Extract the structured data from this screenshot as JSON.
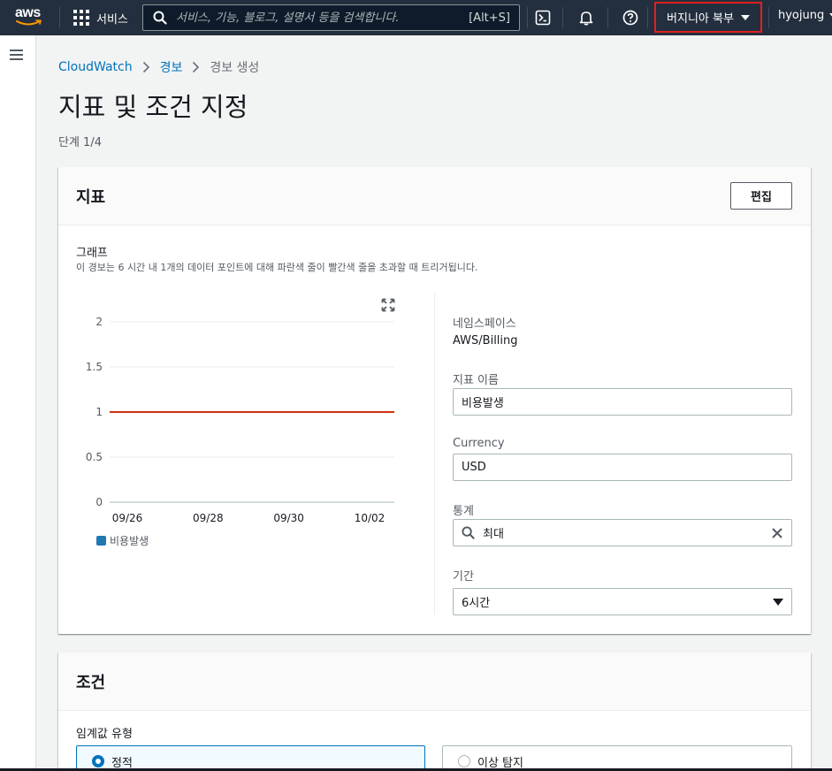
{
  "nav": {
    "services_label": "서비스",
    "search_placeholder": "서비스, 기능, 블로그, 설명서 등을 검색합니다.",
    "search_shortcut": "[Alt+S]",
    "region_label": "버지니아 북부",
    "user_label": "hyojung",
    "logo_text": "aws"
  },
  "breadcrumb": {
    "items": [
      "CloudWatch",
      "경보"
    ],
    "current": "경보 생성"
  },
  "page": {
    "title": "지표 및 조건 지정",
    "step": "단계 1/4"
  },
  "metric_panel": {
    "heading": "지표",
    "edit_button": "편집",
    "graph_title": "그래프",
    "graph_description": "이 경보는 6 시간 내 1개의 데이터 포인트에 대해 파란색 줄이 빨간색 줄을 초과할 때 트리거됩니다.",
    "namespace_label": "네임스페이스",
    "namespace_value": "AWS/Billing",
    "metric_name_label": "지표 이름",
    "metric_name_value": "비용발생",
    "currency_label": "Currency",
    "currency_value": "USD",
    "statistic_label": "통계",
    "statistic_value": "최대",
    "period_label": "기간",
    "period_value": "6시간"
  },
  "chart_data": {
    "type": "line",
    "x": [
      "09/26",
      "09/28",
      "09/30",
      "10/02"
    ],
    "y_ticks": [
      "2",
      "1.5",
      "1",
      "0.5",
      "0"
    ],
    "ylim": [
      0,
      2
    ],
    "series": [
      {
        "name": "비용발생",
        "color": "#1f78b4",
        "values": []
      }
    ],
    "threshold": {
      "value": 1,
      "color": "#d13212"
    },
    "grid": true,
    "legend_position": "bottom-left"
  },
  "conditions_panel": {
    "heading": "조건",
    "threshold_type_label": "임계값 유형",
    "options": [
      {
        "label": "정적",
        "selected": true
      },
      {
        "label": "이상 탐지",
        "selected": false
      }
    ]
  },
  "colors": {
    "nav_bg": "#232f3e",
    "link": "#0073bb",
    "threshold": "#d13212",
    "series": "#1f78b4",
    "region_highlight": "#e02020"
  }
}
